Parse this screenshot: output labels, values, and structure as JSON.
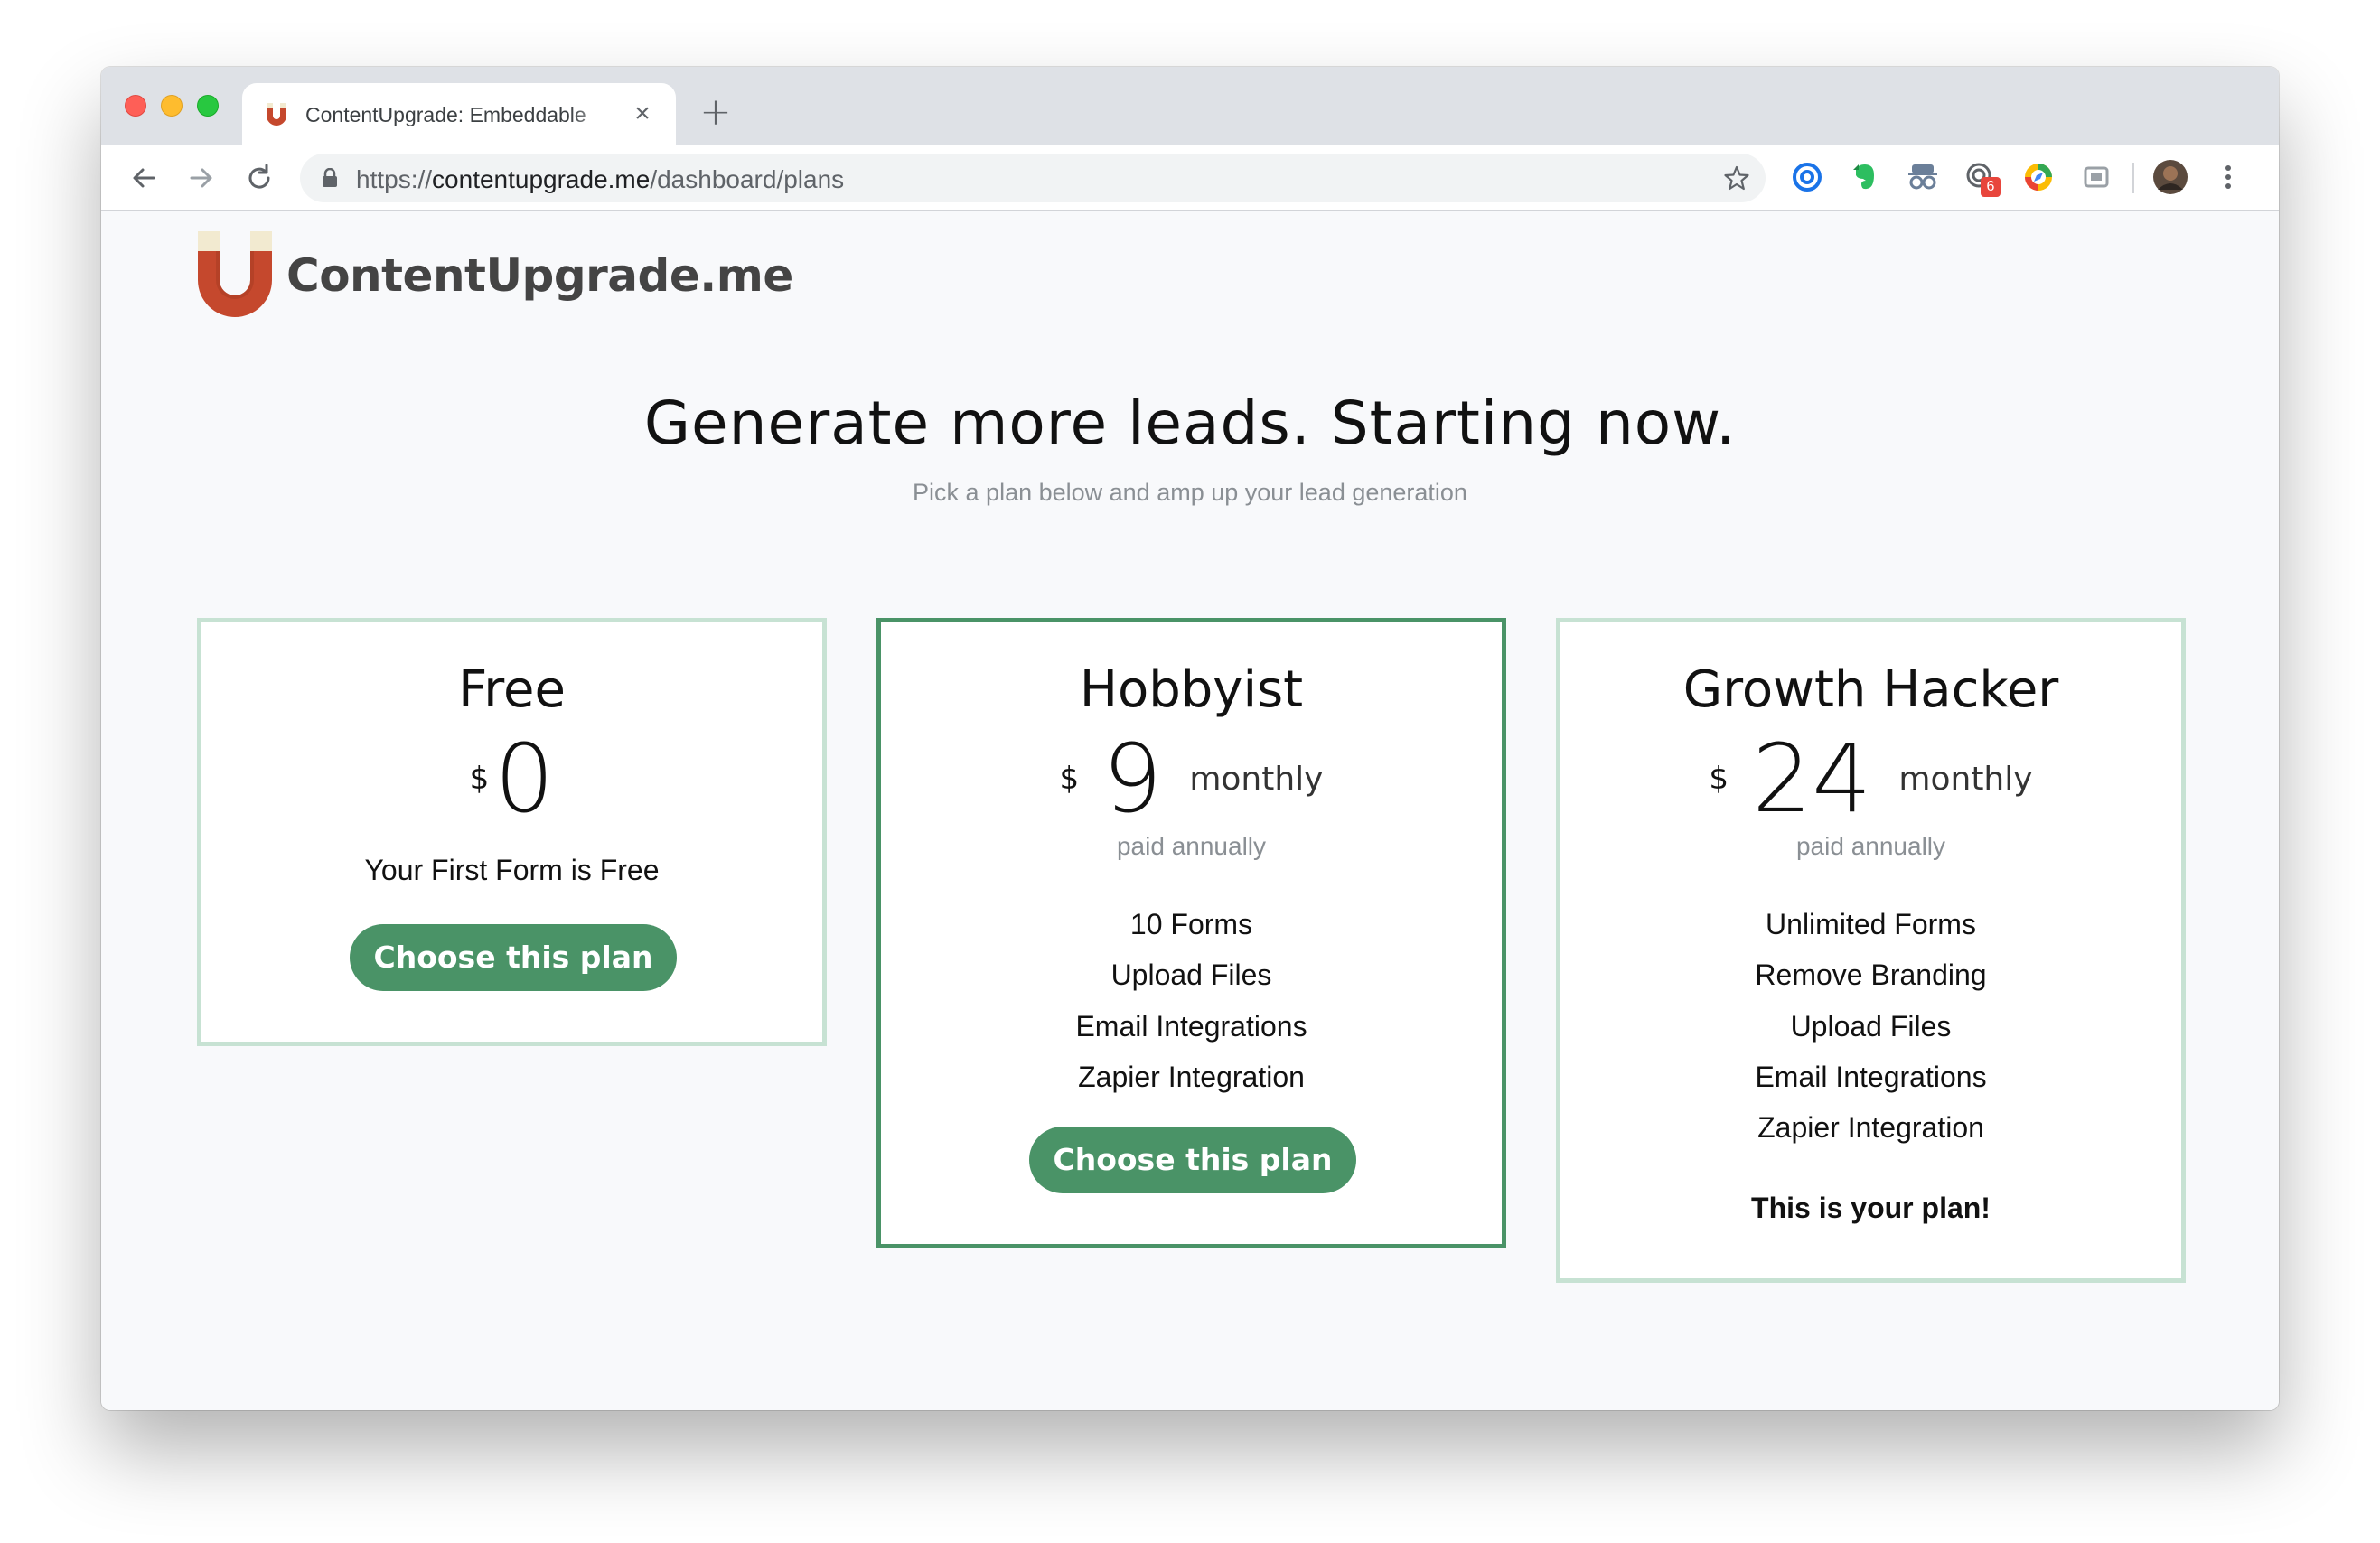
{
  "browser": {
    "tab_title": "ContentUpgrade: Embeddable",
    "tab_close": "×",
    "new_tab": "+",
    "url_scheme": "https://",
    "url_host": "contentupgrade.me",
    "url_path": "/dashboard/plans",
    "extension_badge": "6"
  },
  "brand": {
    "name": "ContentUpgrade.me",
    "accent": "#4a9367",
    "logo_color": "#c5482d"
  },
  "page": {
    "headline": "Generate more leads. Starting now.",
    "subhead": "Pick a plan below and amp up your lead generation"
  },
  "plans": [
    {
      "name": "Free",
      "currency": "$",
      "amount": "0",
      "description": "Your First Form is Free",
      "button": "Choose this plan"
    },
    {
      "name": "Hobbyist",
      "currency": "$",
      "amount": "9",
      "period": "monthly",
      "billing": "paid annually",
      "features": [
        "10 Forms",
        "Upload Files",
        "Email Integrations",
        "Zapier Integration"
      ],
      "button": "Choose this plan"
    },
    {
      "name": "Growth Hacker",
      "currency": "$",
      "amount": "24",
      "period": "monthly",
      "billing": "paid annually",
      "features": [
        "Unlimited Forms",
        "Remove Branding",
        "Upload Files",
        "Email Integrations",
        "Zapier Integration"
      ],
      "status": "This is your plan!"
    }
  ]
}
